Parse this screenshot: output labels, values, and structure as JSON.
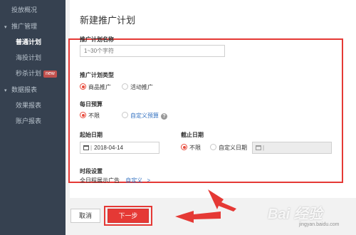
{
  "sidebar": {
    "top_item": "投放概况",
    "group1": "推广管理",
    "items": [
      {
        "label": "普通计划",
        "active": true
      },
      {
        "label": "海投计划",
        "active": false
      },
      {
        "label": "秒杀计划",
        "active": false,
        "badge": "new"
      }
    ],
    "group2": "数据报表",
    "report_items": [
      "效果报表",
      "账户报表"
    ]
  },
  "page_title": "新建推广计划",
  "form": {
    "plan_name_label": "推广计划名称",
    "plan_name_placeholder": "1~30个字符",
    "plan_type_label": "推广计划类型",
    "plan_type_options": [
      "商品推广",
      "活动推广"
    ],
    "plan_type_selected": "商品推广",
    "budget_label": "每日预算",
    "budget_options": [
      "不限",
      "自定义预算"
    ],
    "budget_selected": "不限",
    "start_date_label": "起始日期",
    "start_date_value": "2018-04-14",
    "end_date_label": "截止日期",
    "end_date_options": [
      "不限",
      "自定义日期"
    ],
    "end_date_selected": "不限",
    "end_date_value": "",
    "time_label": "时段设置",
    "time_value": "全日程展示广告",
    "time_link": "自定义",
    "time_link_chevron": ">"
  },
  "buttons": {
    "cancel": "取消",
    "next": "下一步"
  },
  "accent_color": "#e53935",
  "watermark": "Bai 经验",
  "watermark_sub": "jingyan.baidu.com"
}
